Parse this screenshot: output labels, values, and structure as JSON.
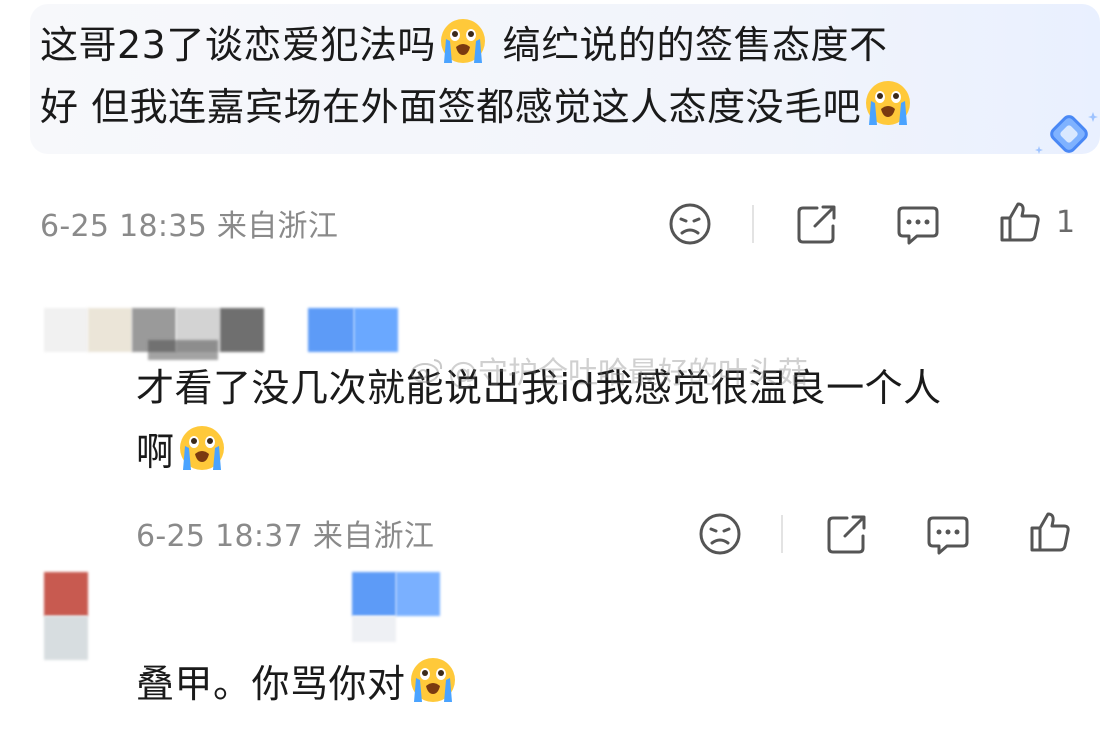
{
  "main_comment": {
    "text_line1": "这哥23了谈恋爱犯法吗",
    "text_line1b": "缟纻说的的签售态度不",
    "text_line2": "好 但我连嘉宾场在外面签都感觉这人态度没毛吧",
    "timestamp": "6-25 18:35 来自浙江",
    "like_count": "1"
  },
  "reply1": {
    "line1": "才看了没几次就能说出我id我感觉很温良一个人",
    "line2": "啊",
    "timestamp": "6-25 18:37 来自浙江"
  },
  "reply2": {
    "text": "叠甲。你骂你对"
  },
  "watermark": {
    "text": "@守护全吐哈最好的叶头菇"
  },
  "icons": [
    "crying-emoji-icon",
    "sad-face-icon",
    "share-icon",
    "comment-icon",
    "thumbs-up-icon",
    "diamond-badge-icon"
  ],
  "colors": {
    "bubble_bg": "#f1f4fb",
    "meta_gray": "#8a8a8a",
    "emoji_yellow": "#ffc93a",
    "tear_blue": "#4aa3ff",
    "avatar_blur_blue": "#6aa8ff"
  }
}
